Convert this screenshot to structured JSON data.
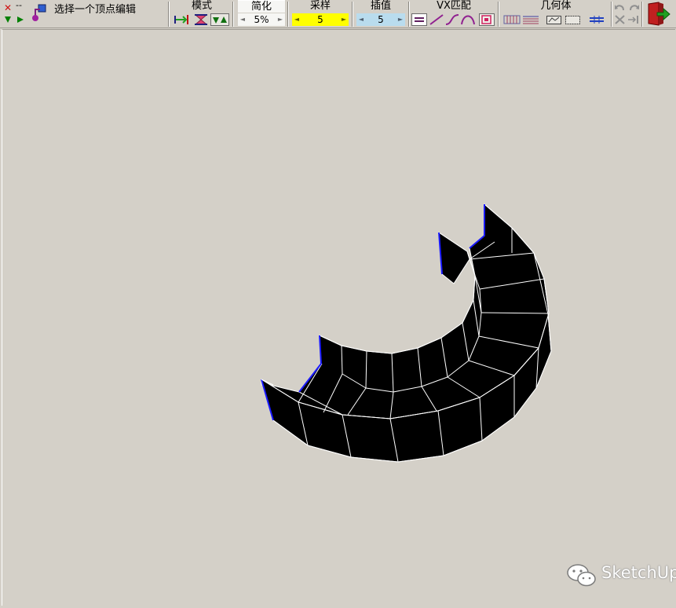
{
  "toolbar": {
    "status_text": "选择一个顶点编辑",
    "top_left_dash": "--",
    "groups": {
      "mode": {
        "title": "模式"
      },
      "simplify": {
        "title": "简化",
        "value": "5%"
      },
      "sample": {
        "title": "采样",
        "value": "5"
      },
      "interp": {
        "title": "插值",
        "value": "5"
      },
      "vx_match": {
        "title": "VX匹配"
      },
      "geometry": {
        "title": "几何体"
      }
    }
  },
  "watermark": {
    "text": "SketchUp"
  },
  "colors": {
    "background": "#d4d0c8",
    "sample_bg": "#ffff00",
    "interp_bg": "#b9dcee",
    "mesh_fill": "#000000",
    "mesh_edge": "#ffffff",
    "end_edge": "#1a1aff"
  }
}
